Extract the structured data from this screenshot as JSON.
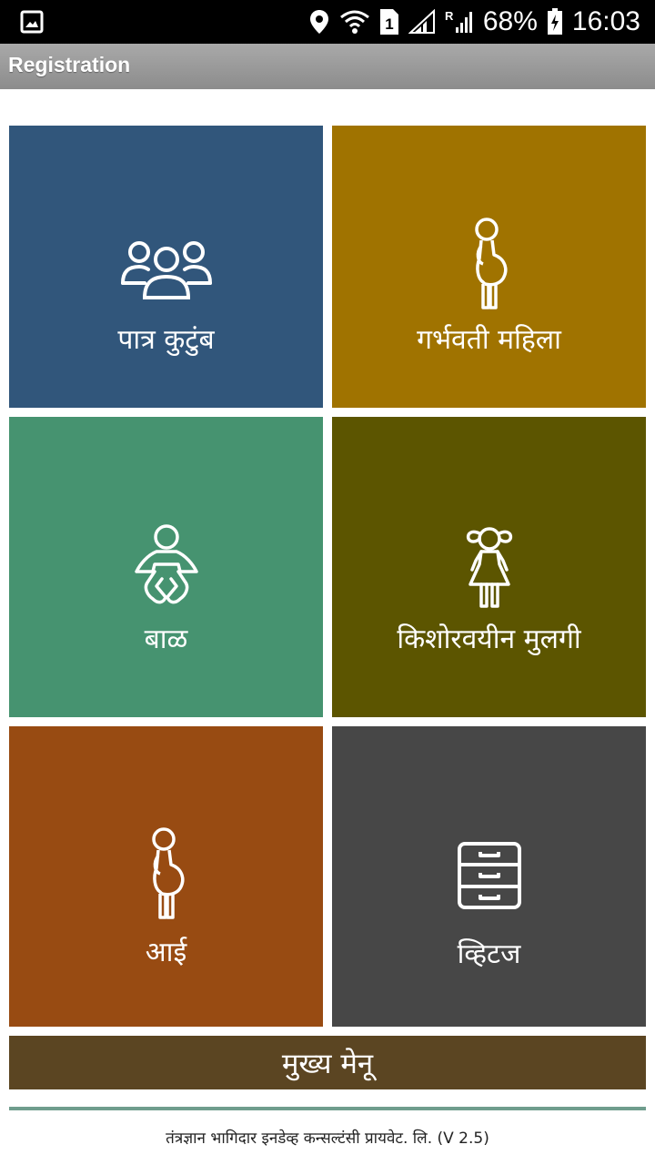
{
  "status_bar": {
    "battery": "68%",
    "time": "16:03",
    "sim_slot": "1",
    "roaming": "R",
    "icons": [
      "image-icon",
      "location-icon",
      "wifi-icon",
      "sim-icon",
      "signal-icon",
      "signal-roaming-icon",
      "battery-charging-icon"
    ]
  },
  "app_bar": {
    "title": "Registration"
  },
  "tiles": [
    {
      "label": "पात्र कुटुंब",
      "color": "#31567b",
      "icon": "family-icon"
    },
    {
      "label": "गर्भवती महिला",
      "color": "#a07300",
      "icon": "pregnant-woman-icon"
    },
    {
      "label": "बाळ",
      "color": "#469370",
      "icon": "baby-icon"
    },
    {
      "label": "किशोरवयीन मुलगी",
      "color": "#5c5500",
      "icon": "girl-icon"
    },
    {
      "label": "आई",
      "color": "#984b12",
      "icon": "mother-icon"
    },
    {
      "label": "व्हिटज",
      "color": "#474747",
      "icon": "cabinet-icon"
    }
  ],
  "main_menu": {
    "label": "मुख्य मेनू",
    "color": "#5b4522"
  },
  "footer": {
    "text": "तंत्रज्ञान भागिदार इनडेव्ह कन्सल्टंसी प्रायवेट. लि. (V 2.5)"
  }
}
